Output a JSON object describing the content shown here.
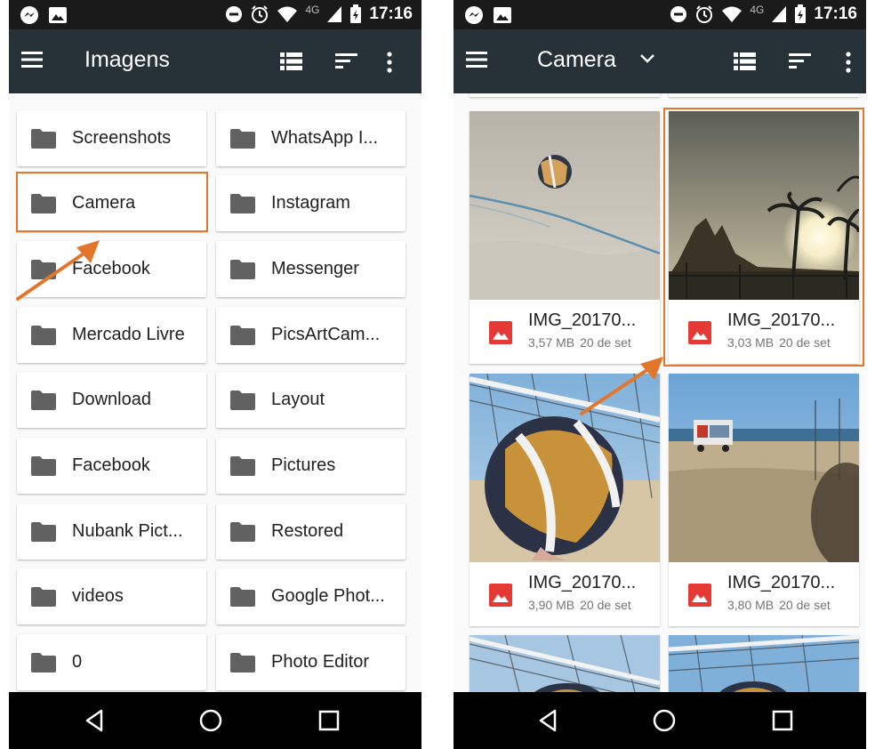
{
  "status_bar": {
    "time": "17:16",
    "network": "4G"
  },
  "left_screen": {
    "title": "Imagens",
    "folders": [
      "Screenshots",
      "WhatsApp I...",
      "Camera",
      "Instagram",
      "Facebook",
      "Messenger",
      "Mercado Livre",
      "PicsArtCam...",
      "Download",
      "Layout",
      "Facebook",
      "Pictures",
      "Nubank Pict...",
      "Restored",
      "videos",
      "Google Phot...",
      "0",
      "Photo Editor"
    ]
  },
  "right_screen": {
    "title": "Camera",
    "images": [
      {
        "name": "IMG_20170...",
        "size": "3,57 MB",
        "date": "20 de set"
      },
      {
        "name": "IMG_20170...",
        "size": "3,03 MB",
        "date": "20 de set"
      },
      {
        "name": "IMG_20170...",
        "size": "3,90 MB",
        "date": "20 de set"
      },
      {
        "name": "IMG_20170...",
        "size": "3,80 MB",
        "date": "20 de set"
      }
    ]
  },
  "colors": {
    "appbar": "#263238",
    "highlight": "#e2772c",
    "image_icon": "#e53935",
    "folder_icon": "#616161"
  }
}
